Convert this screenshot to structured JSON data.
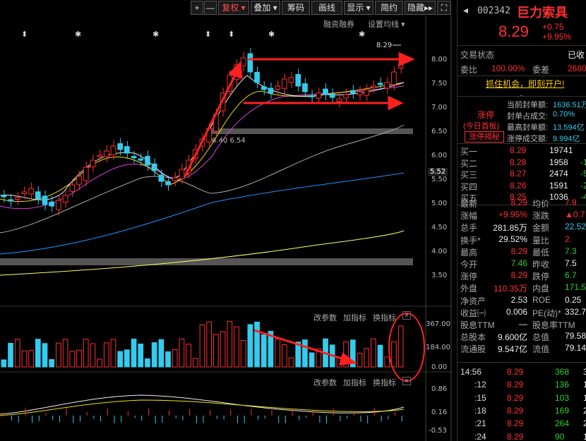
{
  "toolbar": {
    "plus": "+",
    "minus": "—",
    "fuquan": "复权",
    "diejia": "叠加",
    "chouma": "筹码",
    "huaxian": "画线",
    "xianshi": "显示",
    "jianyue": "简约",
    "yincang": "隐藏",
    "expand_icon": "expand-icon"
  },
  "chart_header": {
    "rongzi": "融资融券",
    "junxian": "设置均线"
  },
  "price_axis": [
    "8.00",
    "7.50",
    "7.00",
    "6.50",
    "6.00",
    "5.50",
    "5.00",
    "4.50",
    "4.00",
    "3.50"
  ],
  "current_price_tag": "5.52",
  "high_label": "8.29",
  "annotation_low": "6.40 6.54",
  "volume_axis": [
    "367.00",
    "184.00",
    "0.00"
  ],
  "macd_axis": [
    "0.86",
    "0.16",
    "-0.53"
  ],
  "indicator_controls": {
    "gai": "改参数",
    "jia": "加指标",
    "huan": "换指标"
  },
  "stock": {
    "code": "002342",
    "name": "巨力索具",
    "price": "8.29",
    "change": "+0.75",
    "change_pct": "+9.95%"
  },
  "status": {
    "label": "交易状态",
    "value": "已收",
    "weibi_label": "委比",
    "weibi_value": "100.00%",
    "weicha_label": "委差",
    "weicha_value": "2680"
  },
  "promo": "抓住机会，即刻开户!",
  "limit_up": {
    "tag": "涨停",
    "tag2": "(今日首板)",
    "reveal": "涨停揭秘",
    "lines": [
      {
        "label": "当前封单额:",
        "value": "1636.51万"
      },
      {
        "label": "封单占成交:",
        "value": "0.70%"
      },
      {
        "label": "最高封单额:",
        "value": "13.594亿"
      },
      {
        "label": "涨停成交额:",
        "value": "9.994亿"
      }
    ]
  },
  "order_book": [
    {
      "label": "买一",
      "price": "8.29",
      "vol": "19741",
      "chg": ""
    },
    {
      "label": "买二",
      "price": "8.28",
      "vol": "1958",
      "chg": "-16"
    },
    {
      "label": "买三",
      "price": "8.27",
      "vol": "2474",
      "chg": "-5"
    },
    {
      "label": "买四",
      "price": "8.26",
      "vol": "1591",
      "chg": "-2"
    },
    {
      "label": "买五",
      "price": "8.25",
      "vol": "1036",
      "chg": "-4"
    }
  ],
  "stats": [
    {
      "l1": "最新",
      "v1": "8.29",
      "c1": "red",
      "l2": "均价",
      "v2": "7.9",
      "c2": "red"
    },
    {
      "l1": "涨幅",
      "v1": "+9.95%",
      "c1": "red",
      "l2": "涨跌",
      "v2": "▲0.7",
      "c2": "red"
    },
    {
      "l1": "总手",
      "v1": "281.85万",
      "c1": "white",
      "l2": "金额",
      "v2": "22.52",
      "c2": "cyan"
    },
    {
      "l1": "换手*",
      "v1": "29.52%",
      "c1": "white",
      "l2": "量比",
      "v2": "2.",
      "c2": "red"
    },
    {
      "l1": "最高",
      "v1": "8.29",
      "c1": "red",
      "l2": "最低",
      "v2": "7.3",
      "c2": "green"
    },
    {
      "l1": "今开",
      "v1": "7.46",
      "c1": "green",
      "l2": "昨收",
      "v2": "7.5",
      "c2": "white"
    },
    {
      "l1": "涨停",
      "v1": "8.29",
      "c1": "red",
      "l2": "跌停",
      "v2": "6.7",
      "c2": "green"
    },
    {
      "l1": "外盘",
      "v1": "110.35万",
      "c1": "red",
      "l2": "内盘",
      "v2": "171.51",
      "c2": "green"
    },
    {
      "l1": "净资产",
      "v1": "2.53",
      "c1": "white",
      "l2": "ROE",
      "v2": "0.25",
      "c2": "white"
    },
    {
      "l1": "收益㈠",
      "v1": "0.006",
      "c1": "white",
      "l2": "PE(动)*",
      "v2": "332.7",
      "c2": "white"
    },
    {
      "l1": "股息TTM",
      "v1": "—",
      "c1": "white",
      "l2": "股息率TTM",
      "v2": "",
      "c2": "white"
    },
    {
      "l1": "总股本",
      "v1": "9.600亿",
      "c1": "white",
      "l2": "总值",
      "v2": "79.58",
      "c2": "white"
    },
    {
      "l1": "流通股",
      "v1": "9.547亿",
      "c1": "white",
      "l2": "流值",
      "v2": "79.14",
      "c2": "white"
    }
  ],
  "ticks": [
    {
      "time": "14:56",
      "price": "8.29",
      "vol": "368",
      "n": "3"
    },
    {
      "time": ":12",
      "price": "8.29",
      "vol": "136",
      "n": "1"
    },
    {
      "time": ":15",
      "price": "8.29",
      "vol": "103",
      "n": "1"
    },
    {
      "time": ":18",
      "price": "8.29",
      "vol": "169",
      "n": "2"
    },
    {
      "time": ":21",
      "price": "8.29",
      "vol": "264",
      "n": "2"
    },
    {
      "time": ":24",
      "price": "8.29",
      "vol": "90",
      "n": "1"
    },
    {
      "time": ":27",
      "price": "8.29",
      "vol": "229",
      "n": "3"
    }
  ],
  "colors": {
    "up": "#ff3030",
    "down": "#33ccee",
    "ma5": "#eeeeee",
    "ma10": "#f0e000",
    "ma20": "#e040e0",
    "ma60": "#aaaaaa",
    "ma120": "#1e90ff",
    "ma250": "#ffff66"
  }
}
